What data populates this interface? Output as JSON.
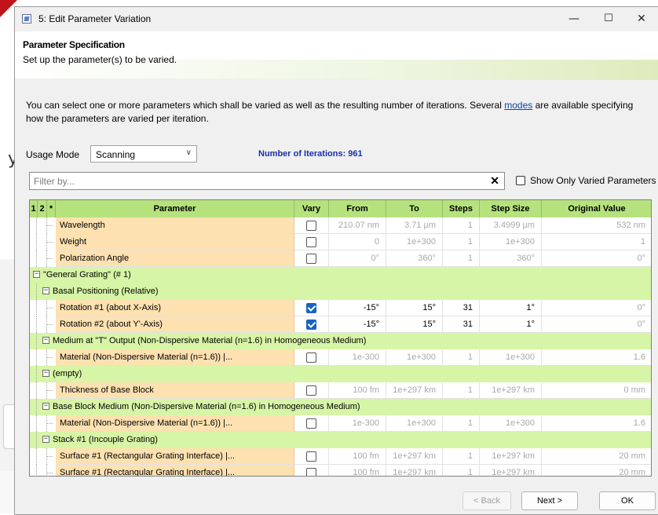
{
  "window": {
    "title": "5: Edit Parameter Variation",
    "minimize": "—",
    "maximize": "☐",
    "close": "✕"
  },
  "header": {
    "title": "Parameter Specification",
    "subtitle": "Set up the parameter(s) to be varied."
  },
  "intro": {
    "text_before": "You can select one or more parameters which shall be varied as well as the resulting number of iterations. Several ",
    "link": "modes",
    "text_after": " are available specifying how the parameters are varied per iteration."
  },
  "usage": {
    "label": "Usage Mode",
    "value": "Scanning",
    "iterations": "Number of Iterations: 961"
  },
  "filter": {
    "placeholder": "Filter by...",
    "clear": "✕",
    "show_only_label": "Show Only Varied Parameters"
  },
  "columns": [
    "1",
    "2",
    "*",
    "Parameter",
    "Vary",
    "From",
    "To",
    "Steps",
    "Step Size",
    "Original Value"
  ],
  "rows": [
    {
      "type": "param",
      "name": "Wavelength",
      "vary": false,
      "from": "210.07 nm",
      "to": "3.71 µm",
      "steps": "1",
      "step_size": "3.4999 µm",
      "original": "532 nm"
    },
    {
      "type": "param",
      "name": "Weight",
      "vary": false,
      "from": "0",
      "to": "1e+300",
      "steps": "1",
      "step_size": "1e+300",
      "original": "1"
    },
    {
      "type": "param",
      "name": "Polarization Angle",
      "vary": false,
      "from": "0°",
      "to": "360°",
      "steps": "1",
      "step_size": "360°",
      "original": "0°"
    },
    {
      "type": "group",
      "level": 0,
      "name": "\"General Grating\" (# 1)"
    },
    {
      "type": "group",
      "level": 1,
      "name": "Basal Positioning (Relative)"
    },
    {
      "type": "param",
      "name": "Rotation #1 (about X-Axis)",
      "vary": true,
      "from": "-15°",
      "to": "15°",
      "steps": "31",
      "step_size": "1°",
      "original": "0°"
    },
    {
      "type": "param",
      "name": "Rotation #2 (about Y'-Axis)",
      "vary": true,
      "from": "-15°",
      "to": "15°",
      "steps": "31",
      "step_size": "1°",
      "original": "0°"
    },
    {
      "type": "group",
      "level": 1,
      "name": "Medium at \"T\" Output (Non-Dispersive Material (n=1.6) in Homogeneous Medium)"
    },
    {
      "type": "param",
      "name": "Material (Non-Dispersive Material (n=1.6)) |...",
      "vary": false,
      "from": "1e-300",
      "to": "1e+300",
      "steps": "1",
      "step_size": "1e+300",
      "original": "1.6"
    },
    {
      "type": "group",
      "level": 1,
      "name": "(empty)"
    },
    {
      "type": "param",
      "name": "Thickness of Base Block",
      "vary": false,
      "from": "100 fm",
      "to": "1e+297 km",
      "steps": "1",
      "step_size": "1e+297 km",
      "original": "0 mm"
    },
    {
      "type": "group",
      "level": 1,
      "name": "Base Block Medium (Non-Dispersive Material (n=1.6) in Homogeneous Medium)"
    },
    {
      "type": "param",
      "name": "Material (Non-Dispersive Material (n=1.6)) |...",
      "vary": false,
      "from": "1e-300",
      "to": "1e+300",
      "steps": "1",
      "step_size": "1e+300",
      "original": "1.6"
    },
    {
      "type": "group",
      "level": 1,
      "name": "Stack #1 (Incouple Grating)"
    },
    {
      "type": "param",
      "name": "Surface #1 (Rectangular Grating Interface) |...",
      "vary": false,
      "from": "100 fm",
      "to": "1e+297 km",
      "steps": "1",
      "step_size": "1e+297 km",
      "original": "20 mm"
    },
    {
      "type": "param",
      "name": "Surface #1 (Rectangular Grating Interface) |...",
      "vary": false,
      "from": "100 fm",
      "to": "1e+297 km",
      "steps": "1",
      "step_size": "1e+297 km",
      "original": "20 mm"
    }
  ],
  "background": {
    "text": "y i"
  },
  "buttons": {
    "back": "< Back",
    "next": "Next >",
    "ok": "OK"
  }
}
